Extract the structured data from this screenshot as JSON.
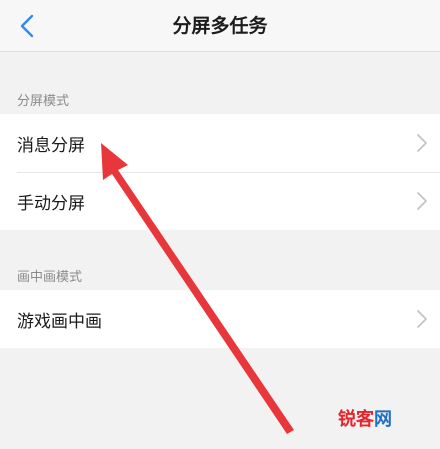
{
  "header": {
    "title": "分屏多任务",
    "back_icon": "chevron-left-icon",
    "accent": "#2f8bf0"
  },
  "sections": [
    {
      "label": "分屏模式",
      "items": [
        {
          "label": "消息分屏",
          "icon": "chevron-right-icon"
        },
        {
          "label": "手动分屏",
          "icon": "chevron-right-icon"
        }
      ]
    },
    {
      "label": "画中画模式",
      "items": [
        {
          "label": "游戏画中画",
          "icon": "chevron-right-icon"
        }
      ]
    }
  ],
  "annotation": {
    "icon": "red-arrow-annotation",
    "color": "#e8373a"
  },
  "watermark": {
    "part1": "锐客",
    "part2": "网"
  }
}
